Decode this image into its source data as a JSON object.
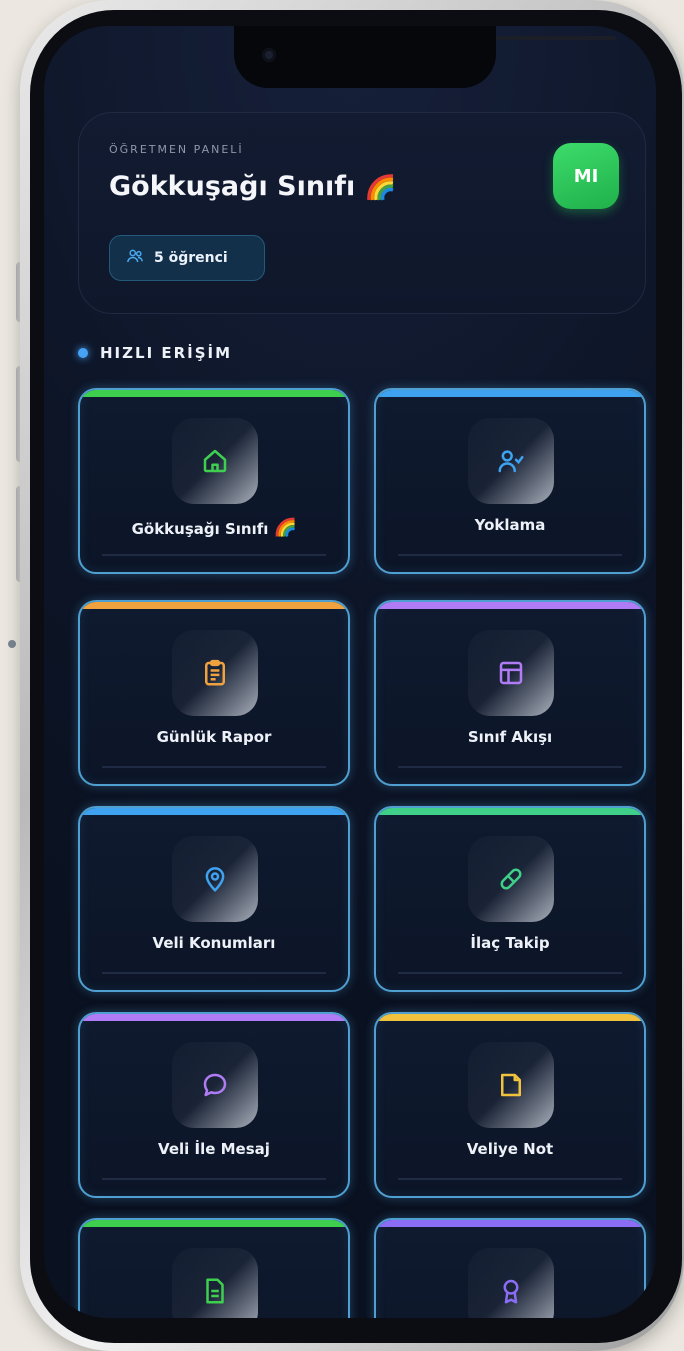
{
  "header": {
    "panel_label": "ÖĞRETMEN PANELİ",
    "class_name": "Gökkuşağı Sınıfı",
    "student_count": "5 öğrenci",
    "avatar_initials": "MI"
  },
  "section": {
    "title": "HIZLI ERİŞİM"
  },
  "tiles": [
    {
      "label": "Gökkuşağı Sınıfı",
      "icon": "home-icon",
      "color": "#3fcf4f",
      "emoji": true
    },
    {
      "label": "Yoklama",
      "icon": "user-check-icon",
      "color": "#3ea2f0"
    },
    {
      "label": "Günlük Rapor",
      "icon": "clipboard-icon",
      "color": "#f0a23e"
    },
    {
      "label": "Sınıf Akışı",
      "icon": "layout-icon",
      "color": "#b07cf5"
    },
    {
      "label": "Veli Konumları",
      "icon": "map-pin-icon",
      "color": "#3ea2f0"
    },
    {
      "label": "İlaç Takip",
      "icon": "pill-icon",
      "color": "#3fcf88"
    },
    {
      "label": "Veli İle Mesaj",
      "icon": "chat-icon",
      "color": "#b07cf5"
    },
    {
      "label": "Veliye Not",
      "icon": "note-icon",
      "color": "#f0c23e"
    },
    {
      "label": "",
      "icon": "document-icon",
      "color": "#3fcf4f"
    },
    {
      "label": "",
      "icon": "award-icon",
      "color": "#8a6cf5"
    }
  ]
}
